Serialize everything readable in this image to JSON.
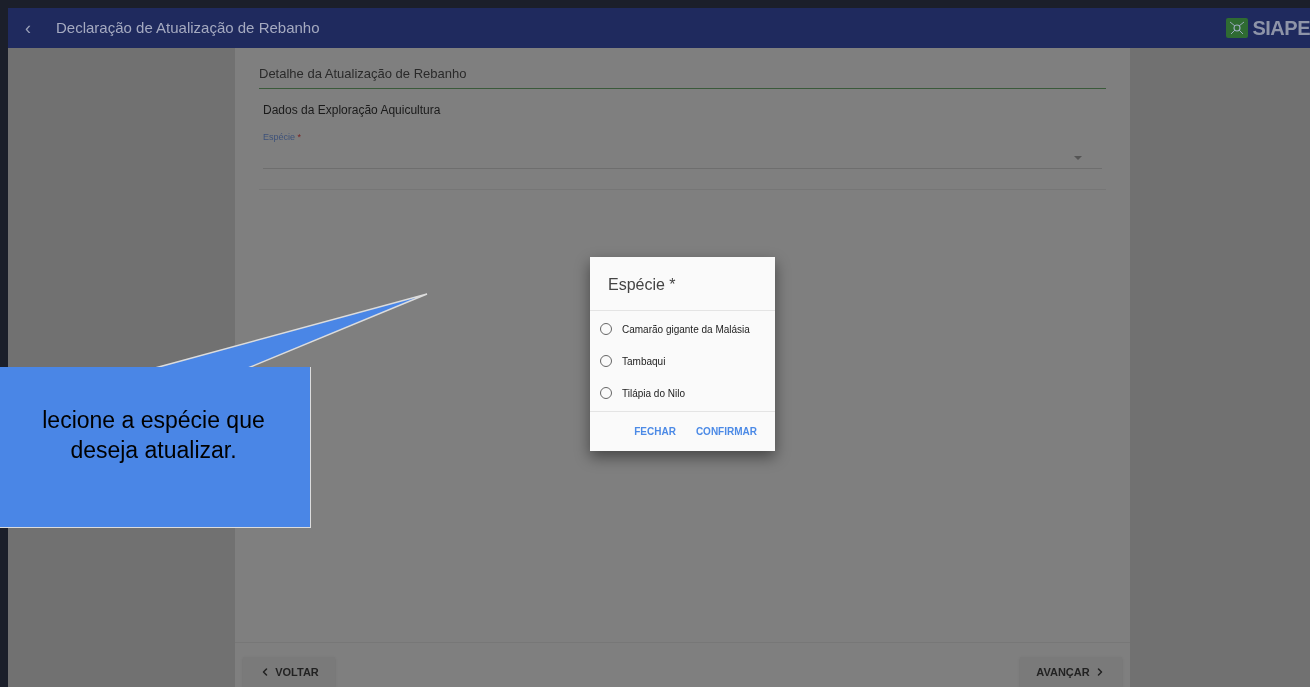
{
  "app_bar": {
    "back": "‹",
    "title": "Declaração de Atualização de Rebanho",
    "logo_text": "SIAPE"
  },
  "form": {
    "heading": "Detalhe da Atualização de Rebanho",
    "section": "Dados da Exploração Aquicultura",
    "field": {
      "label": "Espécie",
      "required": "*"
    }
  },
  "footer": {
    "back_button": "VOLTAR",
    "next_button": "AVANÇAR"
  },
  "dialog": {
    "title": "Espécie *",
    "options": [
      {
        "label": "Camarão gigante da Malásia",
        "selected": false
      },
      {
        "label": "Tambaqui",
        "selected": false
      },
      {
        "label": "Tilápia do Nilo",
        "selected": false
      }
    ],
    "buttons": [
      "FECHAR",
      "CONFIRMAR"
    ]
  },
  "callout": {
    "text": "lecione a espécie que deseja atualizar."
  }
}
